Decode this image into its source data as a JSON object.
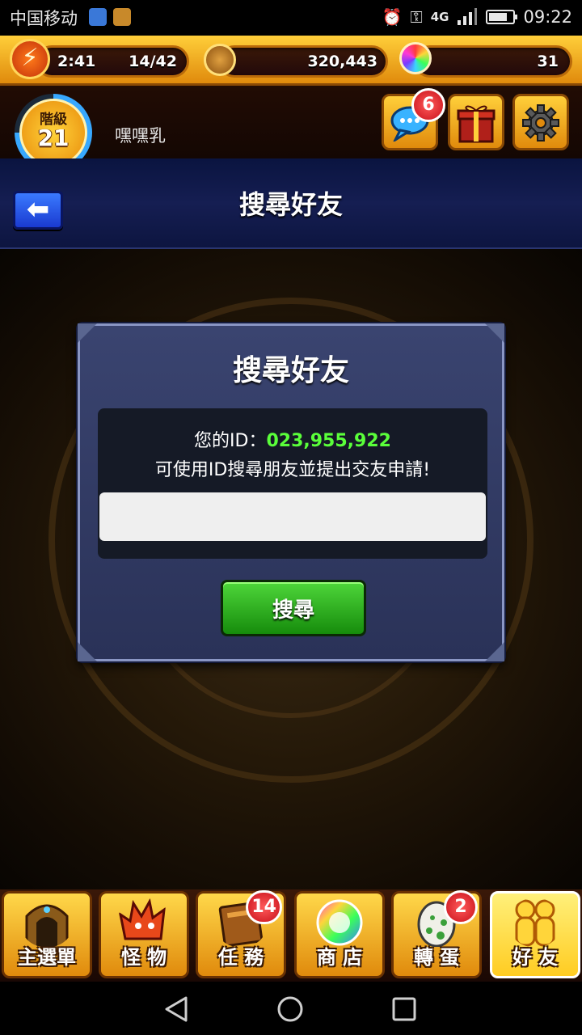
{
  "status_bar": {
    "carrier": "中国移动",
    "network": "4G",
    "time": "09:22"
  },
  "header": {
    "stamina_timer": "2:41",
    "stamina": "14/42",
    "coins": "320,443",
    "orbs": "31",
    "rank_label": "階級",
    "rank": "21",
    "player_name": "嘿嘿乳",
    "chat_badge": "6"
  },
  "title_bar": {
    "title": "搜尋好友"
  },
  "dialog": {
    "title": "搜尋好友",
    "id_label": "您的ID：",
    "id_value": "023,955,922",
    "hint": "可使用ID搜尋朋友並提出交友申請!",
    "input_value": "",
    "search_label": "搜尋"
  },
  "bottom_nav": {
    "items": [
      {
        "label": "主選單",
        "icon": "gate-icon"
      },
      {
        "label": "怪 物",
        "icon": "monster-icon"
      },
      {
        "label": "任 務",
        "icon": "quest-book-icon",
        "badge": "14"
      },
      {
        "label": "商 店",
        "icon": "orb-icon"
      },
      {
        "label": "轉 蛋",
        "icon": "egg-icon",
        "badge": "2"
      },
      {
        "label": "好 友",
        "icon": "friends-icon"
      }
    ]
  },
  "colors": {
    "accent_gold": "#ffcf3a",
    "id_green": "#5aff3a",
    "search_green": "#2aad1a",
    "title_bar_navy": "#151e52"
  }
}
